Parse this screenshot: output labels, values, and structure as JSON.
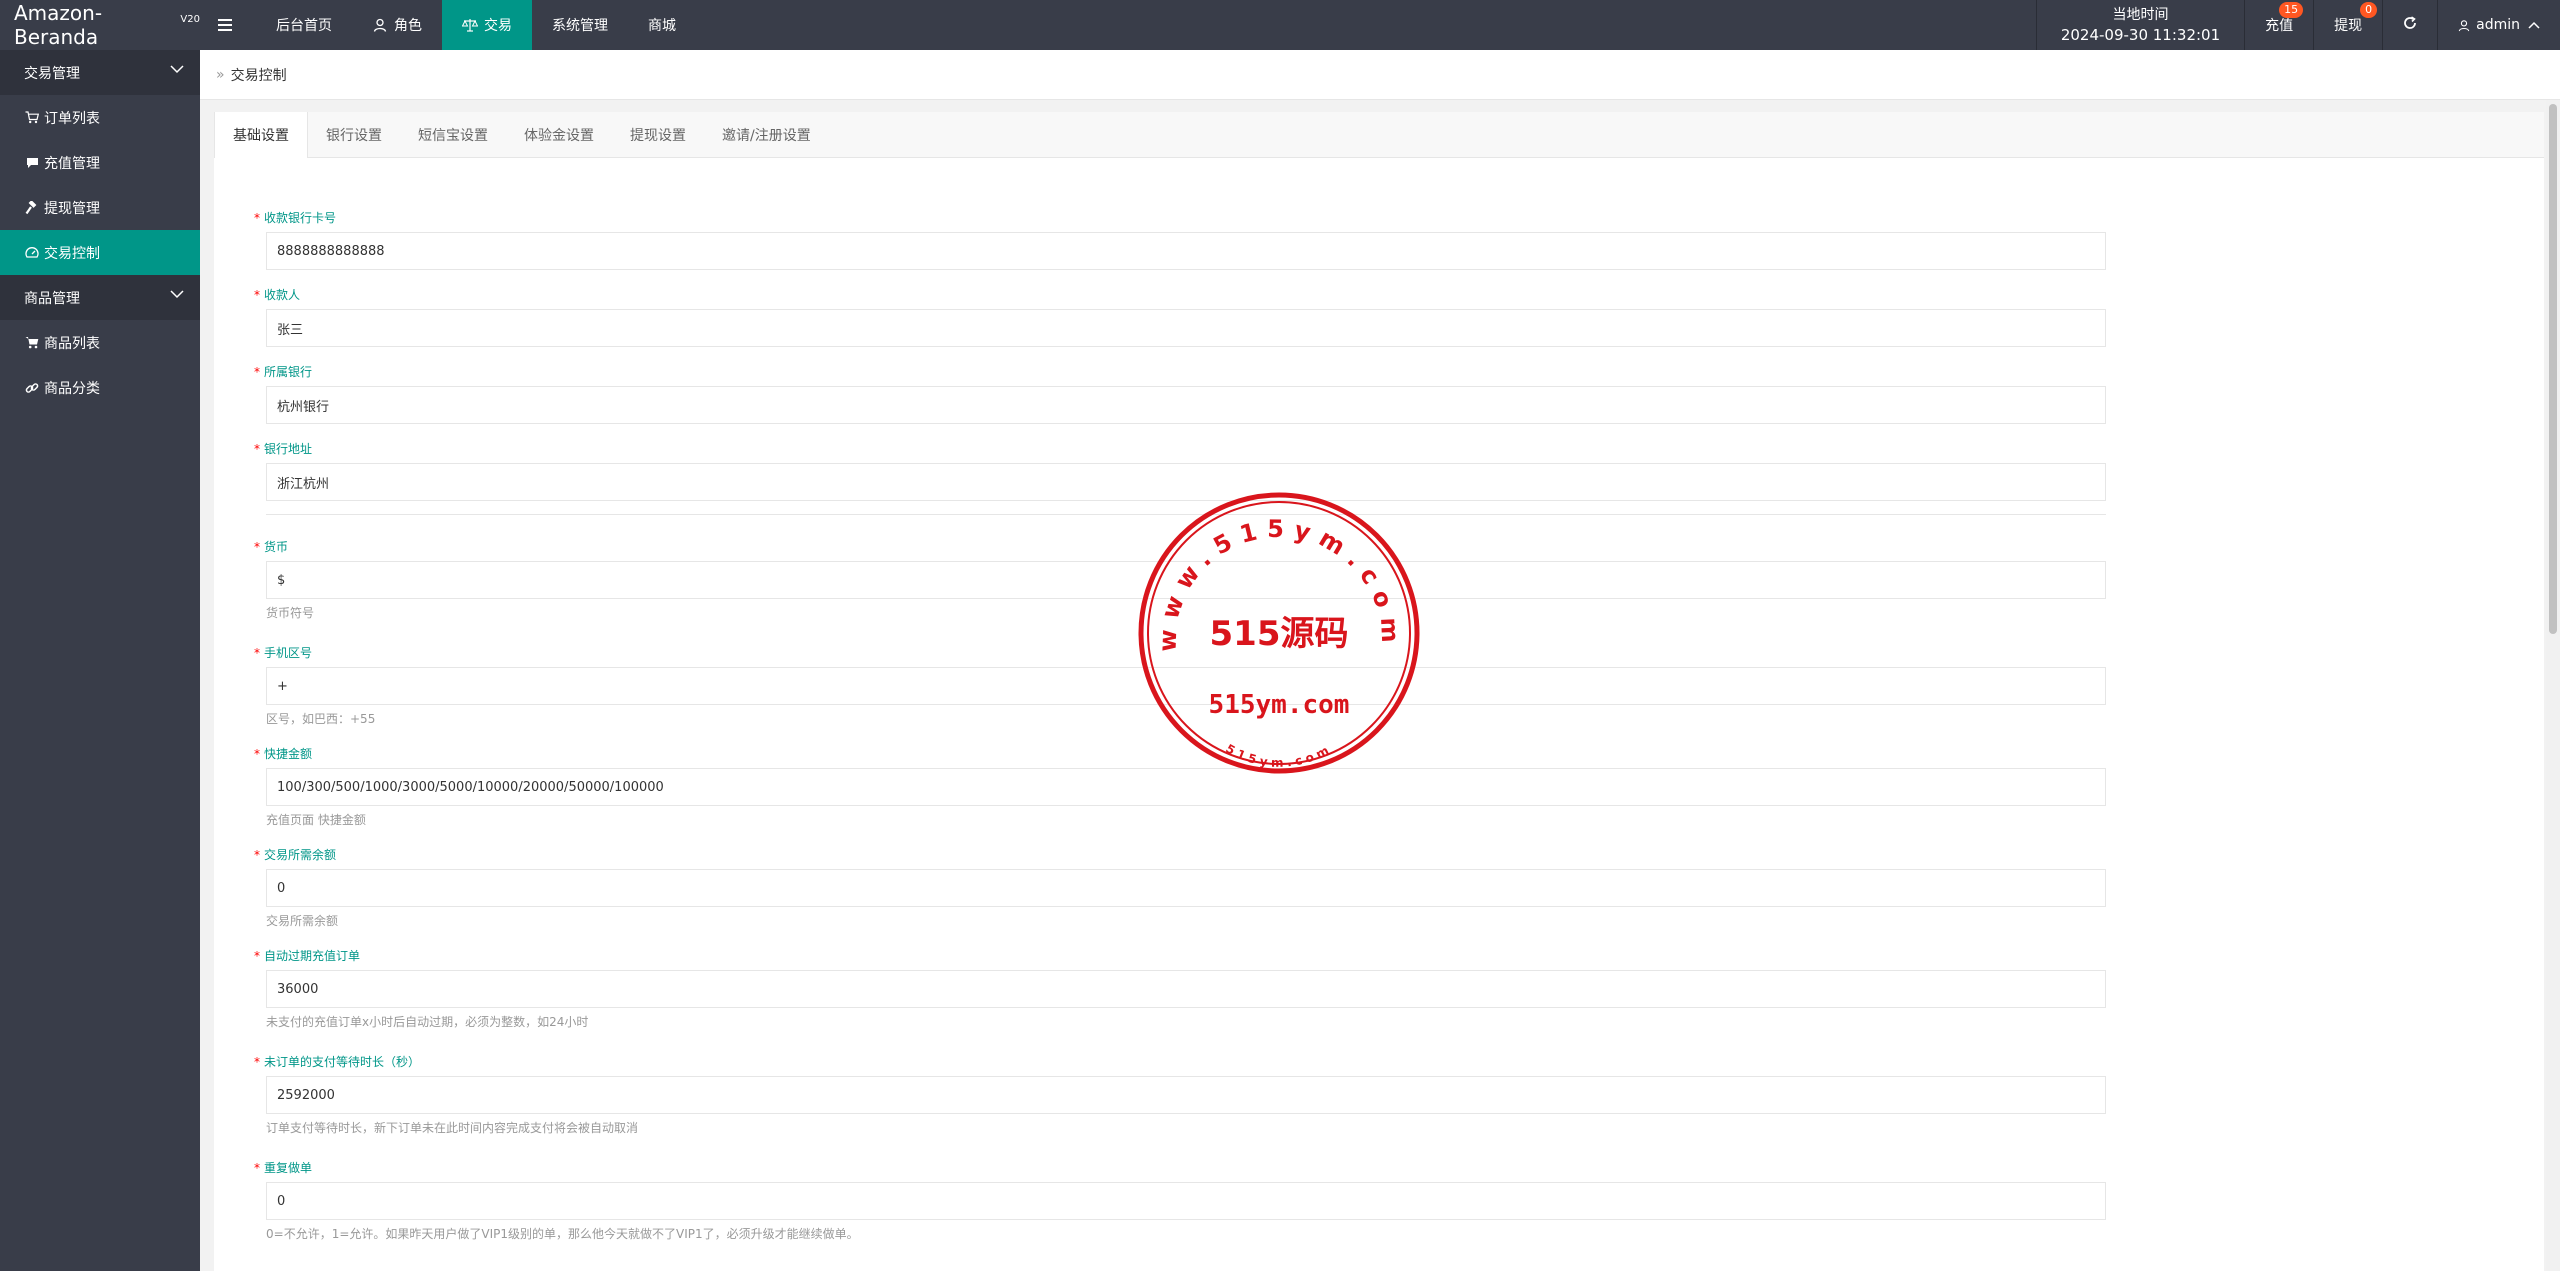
{
  "app": {
    "title": "Amazon-Beranda",
    "version": "V20"
  },
  "topnav": [
    {
      "label": "后台首页",
      "icon": ""
    },
    {
      "label": "角色",
      "icon": "user-icon"
    },
    {
      "label": "交易",
      "icon": "scale-icon",
      "active": true
    },
    {
      "label": "系统管理",
      "icon": ""
    },
    {
      "label": "商城",
      "icon": ""
    }
  ],
  "header_right": {
    "time_label": "当地时间",
    "time_value": "2024-09-30 11:32:01",
    "recharge_label": "充值",
    "recharge_badge": "15",
    "withdraw_label": "提现",
    "withdraw_badge": "0",
    "user": "admin"
  },
  "sidebar": {
    "groups": [
      {
        "label": "交易管理",
        "items": [
          {
            "label": "订单列表",
            "icon": "cart-icon"
          },
          {
            "label": "充值管理",
            "icon": "chat-icon"
          },
          {
            "label": "提现管理",
            "icon": "hammer-icon"
          },
          {
            "label": "交易控制",
            "icon": "gauge-icon",
            "active": true
          }
        ]
      },
      {
        "label": "商品管理",
        "items": [
          {
            "label": "商品列表",
            "icon": "shopping-cart-icon"
          },
          {
            "label": "商品分类",
            "icon": "link-icon"
          }
        ]
      }
    ]
  },
  "breadcrumb": "交易控制",
  "tabs": [
    "基础设置",
    "银行设置",
    "短信宝设置",
    "体验金设置",
    "提现设置",
    "邀请/注册设置"
  ],
  "form": {
    "fields": [
      {
        "label": "收款银行卡号",
        "value": "8888888888888",
        "help": ""
      },
      {
        "label": "收款人",
        "value": "张三",
        "help": ""
      },
      {
        "label": "所属银行",
        "value": "杭州银行",
        "help": ""
      },
      {
        "label": "银行地址",
        "value": "浙江杭州",
        "help": ""
      },
      {
        "label": "货币",
        "value": "$",
        "help": "货币符号"
      },
      {
        "label": "手机区号",
        "value": "+",
        "help": "区号，如巴西：+55"
      },
      {
        "label": "快捷金额",
        "value": "100/300/500/1000/3000/5000/10000/20000/50000/100000",
        "help": "充值页面 快捷金额"
      },
      {
        "label": "交易所需余额",
        "value": "0",
        "help": "交易所需余额"
      },
      {
        "label": "自动过期充值订单",
        "value": "36000",
        "help": "未支付的充值订单x小时后自动过期，必须为整数，如24小时"
      },
      {
        "label": "未订单的支付等待时长（秒）",
        "value": "2592000",
        "help": "订单支付等待时长，新下订单未在此时间内容完成支付将会被自动取消"
      },
      {
        "label": "重复做单",
        "value": "0",
        "help": "0=不允许，1=允许。如果昨天用户做了VIP1级别的单，那么他今天就做不了VIP1了，必须升级才能继续做单。"
      }
    ]
  },
  "watermark": {
    "url": "www.515ym.com",
    "title": "515源码",
    "site": "515ym.com",
    "small": "515ym.com",
    "color": "#d9151c"
  },
  "colors": {
    "header": "#393d49",
    "accent": "#009688",
    "badge": "#ff5722"
  }
}
